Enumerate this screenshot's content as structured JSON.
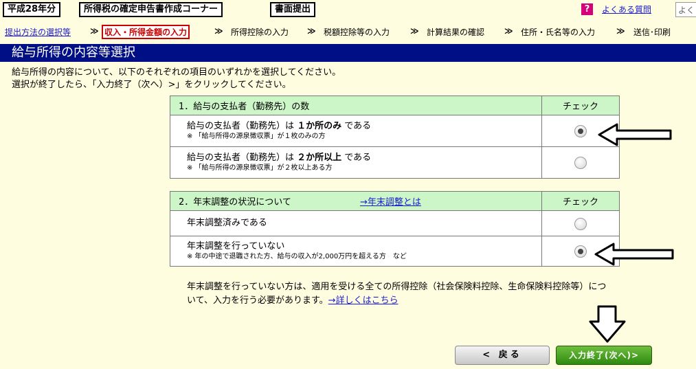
{
  "topbar": {
    "year_label": "平成28年分",
    "corner_title": "所得税の確定申告書作成コーナー",
    "submit_label": "書面提出",
    "faq_icon": "?",
    "faq_link": "よくある質問",
    "search_value": "よく"
  },
  "breadcrumb": {
    "items": [
      {
        "label": "提出方法の選択等"
      },
      {
        "label": "収入・所得金額の入力"
      },
      {
        "label": "所得控除の入力"
      },
      {
        "label": "税額控除等の入力"
      },
      {
        "label": "計算結果の確認"
      },
      {
        "label": "住所・氏名等の入力"
      },
      {
        "label": "送信･印刷"
      }
    ],
    "separator": "≫"
  },
  "section_title": "給与所得の内容等選択",
  "instructions": {
    "line1": "給与所得の内容について、以下のそれぞれの項目のいずれかを選択してください。",
    "line2": "選択が終了したら、「入力終了（次へ）>」をクリックしてください。"
  },
  "q1": {
    "header": "1．給与の支払者（勤務先）の数",
    "check_header": "チェック",
    "options": [
      {
        "pre": "給与の支払者（勤務先）は ",
        "bold": "１か所のみ",
        "post": " である",
        "note": "※ 「給与所得の源泉徴収票」が１枚のみの方",
        "selected": true
      },
      {
        "pre": "給与の支払者（勤務先）は ",
        "bold": "２か所以上",
        "post": " である",
        "note": "※ 「給与所得の源泉徴収票」が２枚以上ある方",
        "selected": false
      }
    ]
  },
  "q2": {
    "header": "2．年末調整の状況について",
    "help_link": "→年末調整とは",
    "check_header": "チェック",
    "options": [
      {
        "label": "年末調整済みである",
        "selected": false
      },
      {
        "label": "年末調整を行っていない",
        "note": "※ 年の中途で退職された方、給与の収入が2,000万円を超える方　など",
        "selected": true
      }
    ]
  },
  "note": {
    "text": "年末調整を行っていない方は、適用を受ける全ての所得控除（社会保険料控除、生命保険料控除等）について、入力を行う必要があります。",
    "link": "→詳しくはこちら"
  },
  "buttons": {
    "back": "< 戻る",
    "next": "入力終了(次へ)>"
  }
}
